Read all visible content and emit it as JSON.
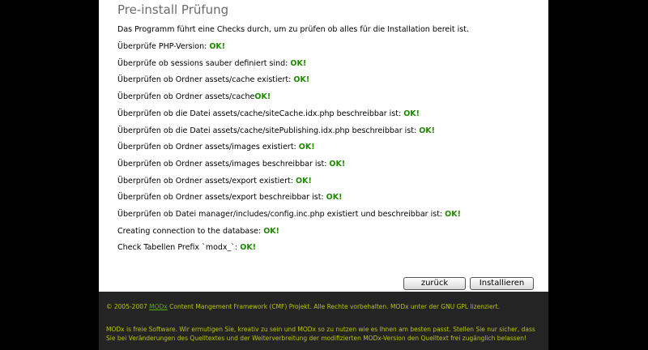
{
  "header": {
    "title": "Pre-install Prüfung"
  },
  "intro": "Das Programm führt eine Checks durch, um zu prüfen ob alles für die Installation bereit ist.",
  "checks": [
    {
      "text": "Überprüfe PHP-Version: ",
      "status": "OK!"
    },
    {
      "text": "Überprüfe ob sessions sauber definiert sind: ",
      "status": "OK!"
    },
    {
      "text": "Überprüfen ob Ordner assets/cache existiert: ",
      "status": "OK!"
    },
    {
      "text": "Überprüfen ob Ordner assets/cache",
      "status": "OK!"
    },
    {
      "text": "Überprüfen ob die Datei assets/cache/siteCache.idx.php beschreibbar ist: ",
      "status": "OK!"
    },
    {
      "text": "Überprüfen ob die Datei assets/cache/sitePublishing.idx.php beschreibbar ist: ",
      "status": "OK!"
    },
    {
      "text": "Überprüfen ob Ordner assets/images existiert: ",
      "status": "OK!"
    },
    {
      "text": "Überprüfen ob Ordner assets/images beschreibbar ist: ",
      "status": "OK!"
    },
    {
      "text": "Überprüfen ob Ordner assets/export existiert: ",
      "status": "OK!"
    },
    {
      "text": "Überprüfen ob Ordner assets/export beschreibbar ist: ",
      "status": "OK!"
    },
    {
      "text": "Überprüfen ob Datei manager/includes/config.inc.php existiert und beschreibbar ist: ",
      "status": "OK!"
    },
    {
      "text": "Creating connection to the database: ",
      "status": "OK!"
    },
    {
      "text": "Check Tabellen Prefix `modx_`: ",
      "status": "OK!"
    }
  ],
  "buttons": {
    "back": "zurück",
    "install": "Installieren"
  },
  "footer": {
    "line1_prefix": "© 2005-2007 ",
    "line1_link": "MODx",
    "line1_suffix": " Content Mangement Framework (CMF) Projekt. Alle Rechte vorbehalten. MODx unter der GNU GPL lizenziert.",
    "line2": "MODx is freie Software. Wir ermutigen Sie, kreativ zu sein und MODx so zu nutzen wie es Ihnen am besten passt. Stellen Sie nur sicher, dass Sie bei Veränderungen des Quelltextes und der Weiterverbreitung der modifizierten MODx-Version den Quelltext frei zugänglich belassen!"
  },
  "colors": {
    "background": "#000000",
    "panel": "#ffffff",
    "ok": "#1f8a00",
    "footer_bg": "#242424",
    "footer_text": "#b8c400"
  }
}
